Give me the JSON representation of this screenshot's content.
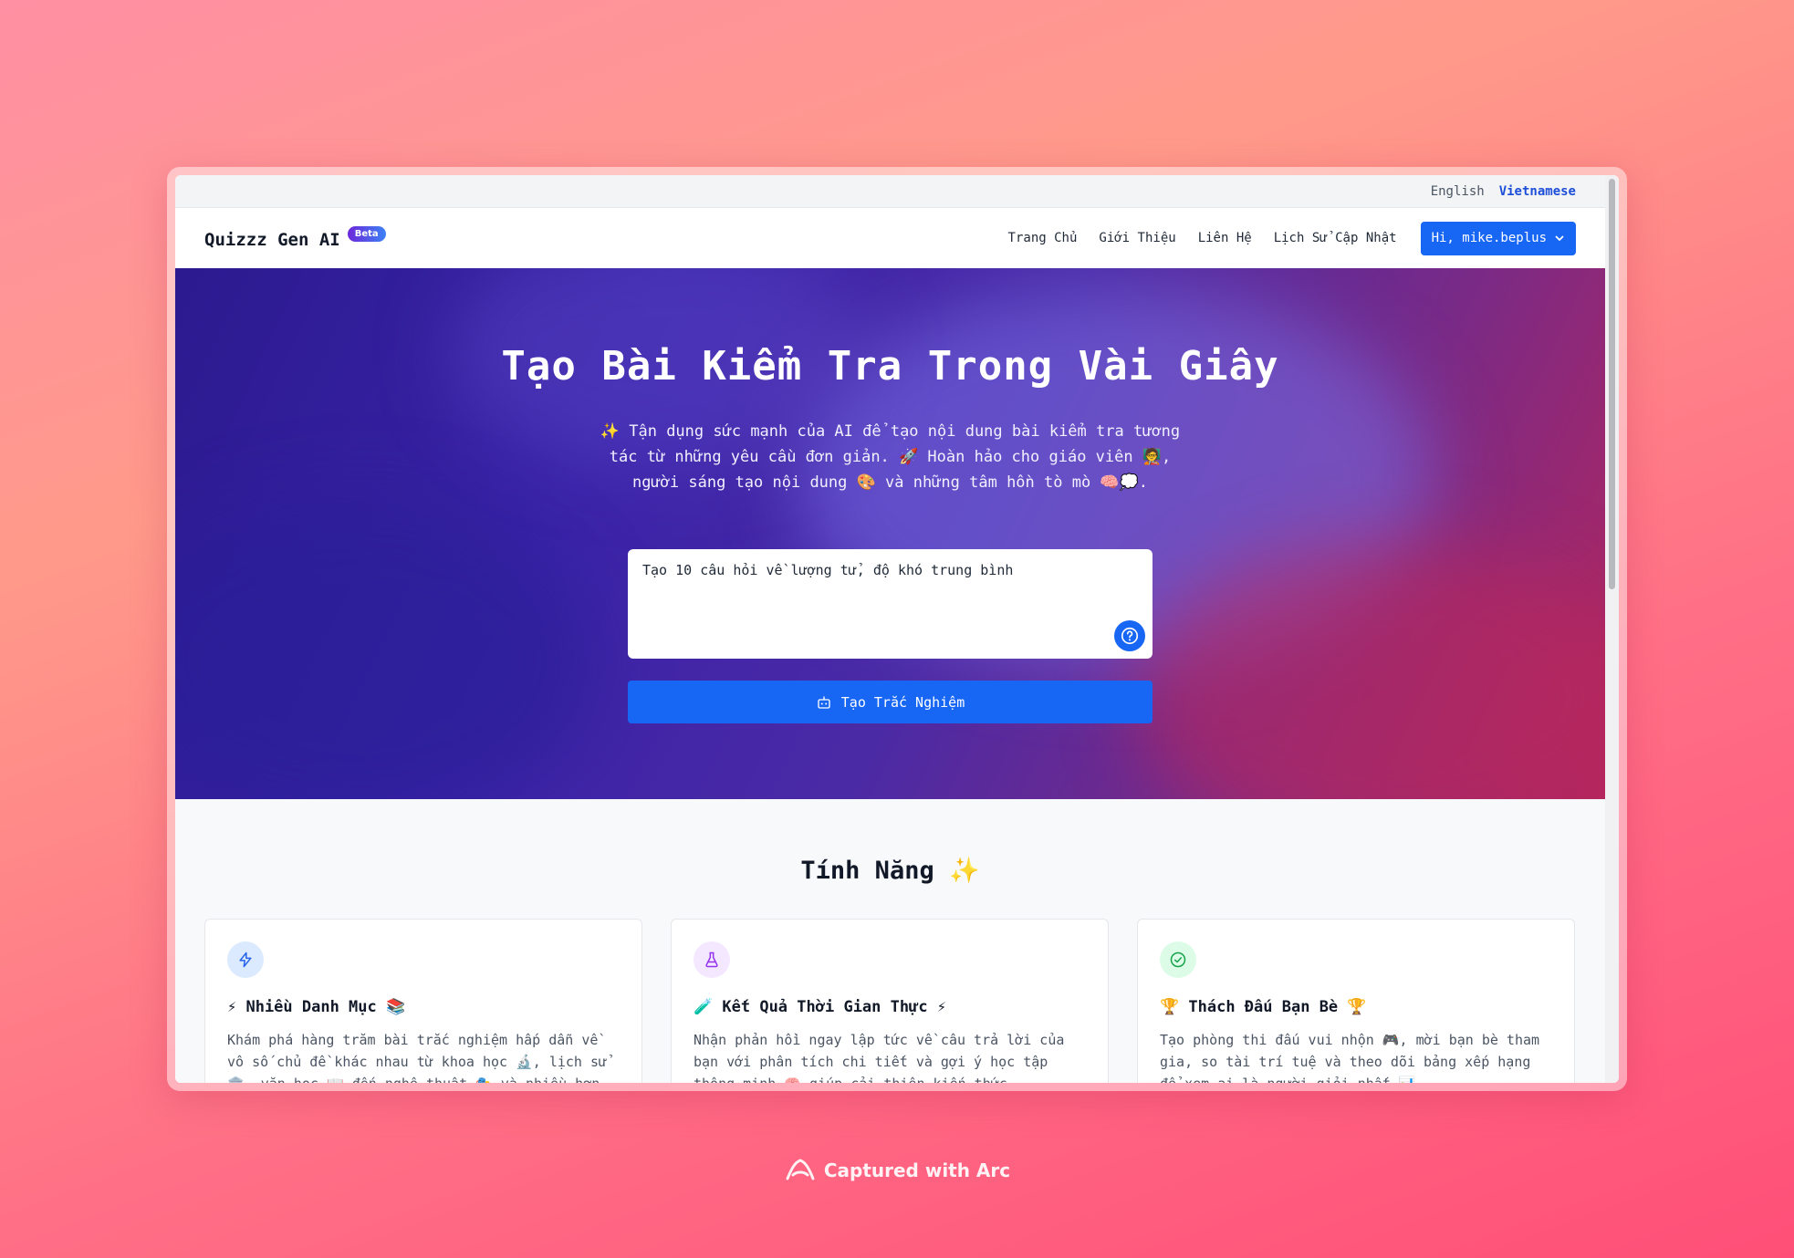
{
  "lang": {
    "english": "English",
    "vietnamese": "Vietnamese"
  },
  "navbar": {
    "brand": "Quizzz Gen AI",
    "badge": "Beta",
    "links": [
      "Trang Chủ",
      "Giới Thiệu",
      "Liên Hệ",
      "Lịch Sử Cập Nhật"
    ],
    "user": "Hi, mike.beplus"
  },
  "hero": {
    "title": "Tạo Bài Kiểm Tra Trong Vài Giây",
    "subtitle": "✨ Tận dụng sức mạnh của AI để tạo nội dung bài kiểm tra tương tác từ những yêu cầu đơn giản. 🚀 Hoàn hảo cho giáo viên 🧑‍🏫, người sáng tạo nội dung 🎨 và những tâm hồn tò mò 🧠💭.",
    "prompt_value": "Tạo 10 câu hỏi về lượng tử, độ khó trung bình",
    "generate_label": "Tạo Trắc Nghiệm"
  },
  "features": {
    "title": "Tính Năng ✨",
    "cards": [
      {
        "title": "⚡ Nhiều Danh Mục 📚",
        "desc": "Khám phá hàng trăm bài trắc nghiệm hấp dẫn về vô số chủ đề khác nhau từ khoa học 🔬, lịch sử 🏛️, văn học 📖 đến nghệ thuật 🎭 và nhiều hơn nữa.",
        "icon": "bolt-icon",
        "accent": "#2563eb",
        "tint": "#dbeafe"
      },
      {
        "title": "🧪 Kết Quả Thời Gian Thực ⚡",
        "desc": "Nhận phản hồi ngay lập tức về câu trả lời của bạn với phân tích chi tiết và gợi ý học tập thông minh 🧠 giúp cải thiện kiến thức.",
        "icon": "flask-icon",
        "accent": "#9333ea",
        "tint": "#f3e8ff"
      },
      {
        "title": "🏆 Thách Đấu Bạn Bè 🏆",
        "desc": "Tạo phòng thi đấu vui nhộn 🎮, mời bạn bè tham gia, so tài trí tuệ và theo dõi bảng xếp hạng để xem ai là người giỏi nhất 📊.",
        "icon": "check-circle-icon",
        "accent": "#16a34a",
        "tint": "#dcfce7"
      }
    ]
  },
  "watermark": "Captured with Arc"
}
